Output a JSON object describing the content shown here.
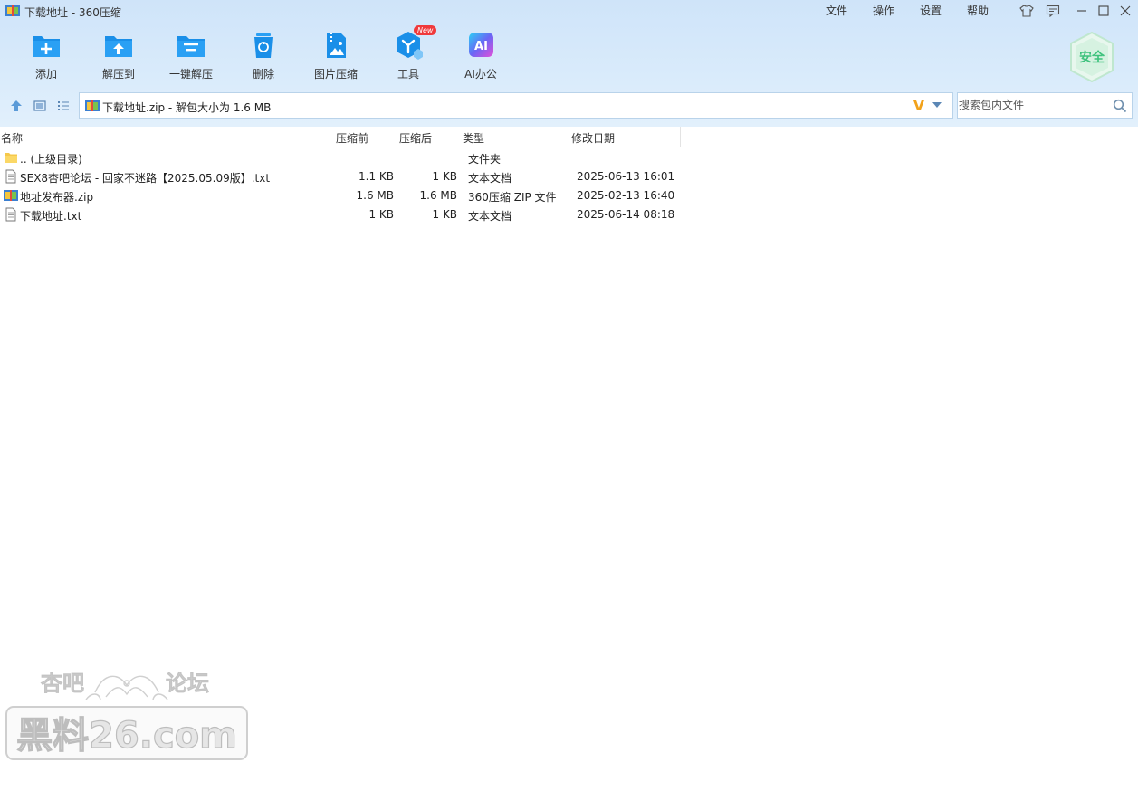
{
  "window": {
    "title": "下载地址 - 360压缩",
    "menu": [
      "文件",
      "操作",
      "设置",
      "帮助"
    ]
  },
  "toolbar": {
    "items": [
      {
        "label": "添加",
        "icon": "add-archive-icon"
      },
      {
        "label": "解压到",
        "icon": "extract-to-icon"
      },
      {
        "label": "一键解压",
        "icon": "one-click-extract-icon"
      },
      {
        "label": "删除",
        "icon": "delete-icon"
      },
      {
        "label": "图片压缩",
        "icon": "image-compress-icon"
      },
      {
        "label": "工具",
        "icon": "tools-icon",
        "badge": "New"
      },
      {
        "label": "AI办公",
        "icon": "ai-office-icon",
        "glyph": "AI"
      }
    ],
    "safe_badge": "安全"
  },
  "address": {
    "path": "下载地址.zip - 解包大小为 1.6 MB",
    "v_badge": "V"
  },
  "search": {
    "placeholder": "搜索包内文件"
  },
  "table": {
    "columns": [
      "名称",
      "压缩前",
      "压缩后",
      "类型",
      "修改日期"
    ],
    "rows": [
      {
        "icon": "folder-icon",
        "name": ".. (上级目录)",
        "before": "",
        "after": "",
        "type": "文件夹",
        "date": ""
      },
      {
        "icon": "text-file-icon",
        "name": "SEX8杏吧论坛 - 回家不迷路【2025.05.09版】.txt",
        "before": "1.1 KB",
        "after": "1 KB",
        "type": "文本文档",
        "date": "2025-06-13 16:01"
      },
      {
        "icon": "zip-file-icon",
        "name": "地址发布器.zip",
        "before": "1.6 MB",
        "after": "1.6 MB",
        "type": "360压缩 ZIP 文件",
        "date": "2025-02-13 16:40"
      },
      {
        "icon": "text-file-icon",
        "name": "下载地址.txt",
        "before": "1 KB",
        "after": "1 KB",
        "type": "文本文档",
        "date": "2025-06-14 08:18"
      }
    ]
  },
  "watermark": {
    "line1_left": "杏吧",
    "line1_right": "论坛",
    "line2": "黑料26.com"
  },
  "colors": {
    "accent": "#1a8fe8",
    "toolbar_bg": "#d5e8fa",
    "badge_red": "#f0393b",
    "safe_green": "#3ec27d"
  }
}
